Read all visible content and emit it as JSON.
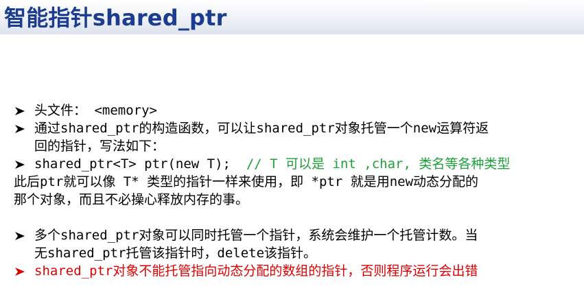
{
  "slide": {
    "title": "智能指针shared_ptr"
  },
  "bullets": {
    "header_file": "头文件： <memory>",
    "constructor_line1": "通过shared_ptr的构造函数，可以让shared_ptr对象托管一个new运算符返",
    "constructor_line2": "回的指针，写法如下：",
    "syntax_code": "shared_ptr<T> ptr(new T);  ",
    "syntax_comment": "// T 可以是 int ,char, 类名等各种类型",
    "usage_line1": "此后ptr就可以像 T* 类型的指针一样来使用，即 *ptr 就是用new动态分配的",
    "usage_line2": "那个对象，而且不必操心释放内存的事。",
    "multiple_line1": "多个shared_ptr对象可以同时托管一个指针，系统会维护一个托管计数。当",
    "multiple_line2": "无shared_ptr托管该指针时，delete该指针。",
    "warning": "shared_ptr对象不能托管指向动态分配的数组的指针，否则程序运行会出错"
  },
  "colors": {
    "title": "#1b3c8f",
    "text": "#000000",
    "comment": "#1ea03a",
    "warning": "#e00000"
  },
  "icons": {
    "bullet": "arrowhead-bullet-icon"
  }
}
